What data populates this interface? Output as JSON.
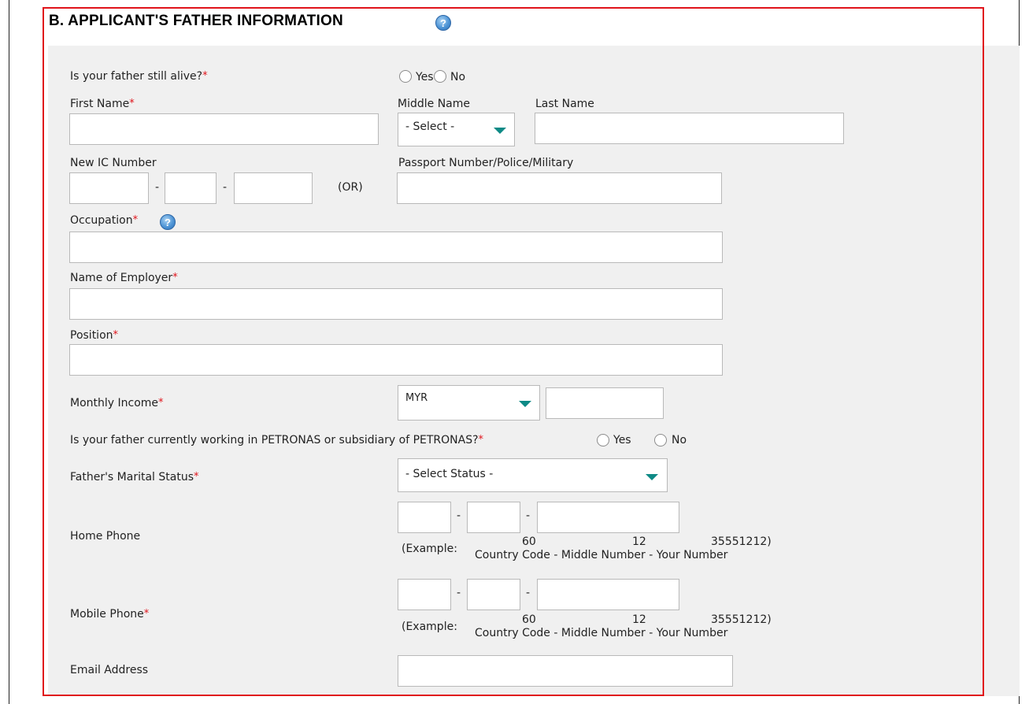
{
  "section": {
    "title": "B. APPLICANT'S FATHER INFORMATION",
    "help_icon": "question-icon"
  },
  "required_marker": "*",
  "alive": {
    "label": "Is your father still alive?",
    "yes": "Yes",
    "no": "No"
  },
  "name": {
    "first_label": "First Name",
    "middle_label": "Middle Name",
    "middle_value": "- Select -",
    "last_label": "Last Name"
  },
  "ic": {
    "label": "New IC Number",
    "sep": "-",
    "or": "(OR)",
    "passport_label": "Passport Number/Police/Military"
  },
  "occupation": {
    "label": "Occupation"
  },
  "employer": {
    "label": "Name of Employer"
  },
  "position": {
    "label": "Position"
  },
  "income": {
    "label": "Monthly Income",
    "currency": "MYR"
  },
  "petronas": {
    "label": "Is your father currently working in PETRONAS or subsidiary of PETRONAS?",
    "yes": "Yes",
    "no": "No"
  },
  "marital": {
    "label": "Father's Marital Status",
    "value": "- Select Status -"
  },
  "home_phone": {
    "label": "Home Phone",
    "example_prefix": "(Example:",
    "example_cc": "60",
    "example_mid": "12",
    "example_num": "35551212)",
    "example_caption": "Country Code - Middle Number - Your Number"
  },
  "mobile_phone": {
    "label": "Mobile Phone",
    "example_prefix": "(Example:",
    "example_cc": "60",
    "example_mid": "12",
    "example_num": "35551212)",
    "example_caption": "Country Code - Middle Number - Your Number"
  },
  "email": {
    "label": "Email Address"
  },
  "colors": {
    "required": "#e0141b",
    "border": "#e0141b",
    "caret": "#0e8a86",
    "panel": "#f0f0f0"
  }
}
